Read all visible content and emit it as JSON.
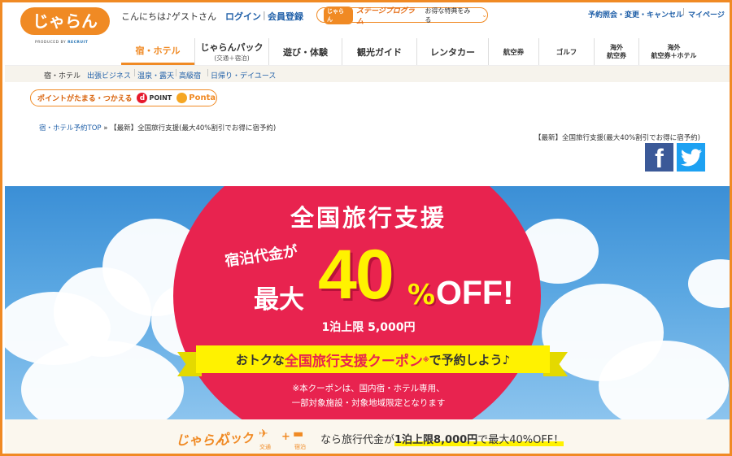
{
  "header": {
    "logo_text": "じゃらん",
    "logo_sub": "PRODUCED BY",
    "logo_brand": "RECRUIT",
    "greeting": "こんにちは♪ゲストさん",
    "login": "ログイン",
    "register": "会員登録",
    "stage_badge": "じゃらん",
    "stage_label": "ステージプログラム",
    "stage_sub": "お得な特典をみる",
    "util_links": [
      "予約照会・変更・キャンセル",
      "マイページ"
    ]
  },
  "nav": [
    {
      "label": "宿・ホテル",
      "sub": ""
    },
    {
      "label": "じゃらんパック",
      "sub": "(交通＋宿泊)"
    },
    {
      "label": "遊び・体験",
      "sub": ""
    },
    {
      "label": "観光ガイド",
      "sub": ""
    },
    {
      "label": "レンタカー",
      "sub": ""
    },
    {
      "label": "航空券",
      "sub": ""
    },
    {
      "label": "ゴルフ",
      "sub": ""
    },
    {
      "label": "海外",
      "sub": "航空券"
    },
    {
      "label": "海外",
      "sub": "航空券＋ホテル"
    }
  ],
  "subnav": [
    "宿・ホテル",
    "出張ビジネス",
    "温泉・露天",
    "高級宿",
    "日帰り・デイユース"
  ],
  "points": {
    "label": "ポイントがたまる・つかえる",
    "dpoint": "POINT",
    "ponta": "Ponta"
  },
  "breadcrumb": {
    "home": "宿・ホテル予約TOP",
    "separator": "»",
    "current": "【最新】全国旅行支援(最大40%割引でお得に宿予約)"
  },
  "page_title": "【最新】全国旅行支援(最大40%割引でお得に宿予約)",
  "hero": {
    "title": "全国旅行支援",
    "shuku": "宿泊代金が",
    "saidai": "最大",
    "forty": "40",
    "pct": "%",
    "off": "OFF!",
    "limit": "1泊上限 5,000円",
    "ribbon_pre": "おトクな",
    "ribbon_hl": "全国旅行支援クーポン",
    "ribbon_note": "※",
    "ribbon_post": "で予約しよう♪",
    "note1": "※本クーポンは、国内宿・ホテル専用、",
    "note2": "一部対象施設・対象地域限定となります"
  },
  "bottom_banner": {
    "logo": "じゃらん",
    "pack": "パック",
    "icon1_label": "交通",
    "icon2_label": "宿泊",
    "text_pre": "なら旅行代金が",
    "text_bold": "1泊上限8,000円",
    "text_post": "で最大40%OFF！"
  },
  "colors": {
    "accent": "#f08a24",
    "link": "#1f5fa8",
    "hero_red": "#e8234f",
    "hero_yellow": "#fff200",
    "facebook": "#3b5998",
    "twitter": "#1da1f2"
  }
}
